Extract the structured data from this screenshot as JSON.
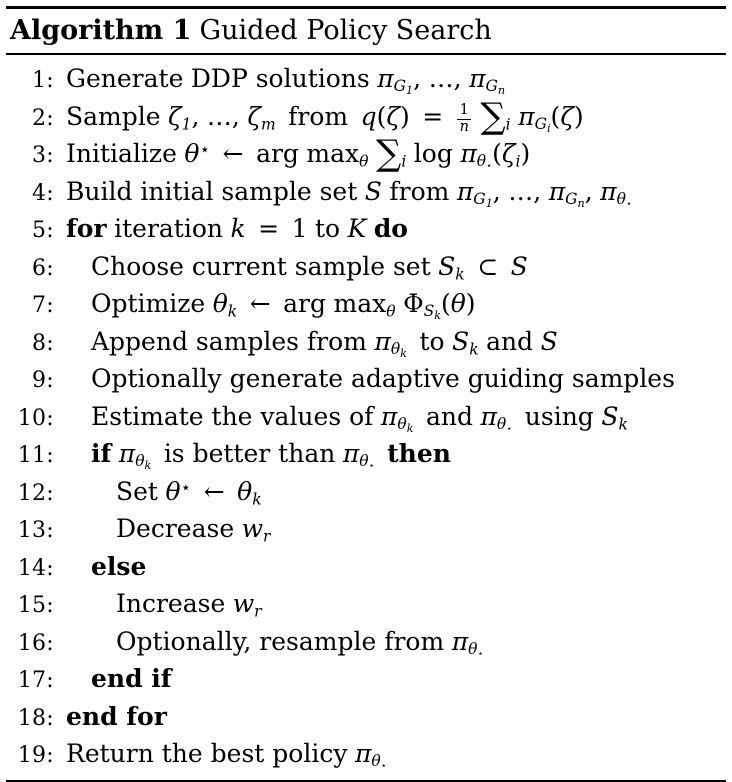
{
  "algorithm": {
    "keyword": "Algorithm 1",
    "caption": "Guided Policy Search",
    "lines": [
      {
        "n": "1:",
        "indent": 0
      },
      {
        "n": "2:",
        "indent": 0
      },
      {
        "n": "3:",
        "indent": 0
      },
      {
        "n": "4:",
        "indent": 0
      },
      {
        "n": "5:",
        "indent": 0
      },
      {
        "n": "6:",
        "indent": 1
      },
      {
        "n": "7:",
        "indent": 1
      },
      {
        "n": "8:",
        "indent": 1
      },
      {
        "n": "9:",
        "indent": 1
      },
      {
        "n": "10:",
        "indent": 1
      },
      {
        "n": "11:",
        "indent": 1
      },
      {
        "n": "12:",
        "indent": 2
      },
      {
        "n": "13:",
        "indent": 2
      },
      {
        "n": "14:",
        "indent": 1
      },
      {
        "n": "15:",
        "indent": 2
      },
      {
        "n": "16:",
        "indent": 2
      },
      {
        "n": "17:",
        "indent": 1
      },
      {
        "n": "18:",
        "indent": 0
      },
      {
        "n": "19:",
        "indent": 0
      }
    ],
    "text": {
      "l1": "Generate DDP solutions π_{𝒢₁}, … , π_{𝒢ₙ}",
      "l2": "Sample ζ₁, … , ζₘ from q(ζ) = (1/n) ∑ᵢ π_{𝒢ᵢ}(ζ)",
      "l3": "Initialize θ⋆ ← arg max_θ ∑ᵢ log π_{θ⋆}(ζᵢ)",
      "l4": "Build initial sample set 𝒮 from π_{𝒢₁}, … , π_{𝒢ₙ}, π_{θ⋆}",
      "l5": "for iteration k = 1 to K do",
      "l6": "Choose current sample set 𝒮ₖ ⊂ 𝒮",
      "l7": "Optimize θₖ ← arg max_θ Φ_{𝒮ₖ}(θ)",
      "l8": "Append samples from π_{θₖ} to 𝒮ₖ and 𝒮",
      "l9": "Optionally generate adaptive guiding samples",
      "l10": "Estimate the values of π_{θₖ} and π_{θ⋆} using 𝒮ₖ",
      "l11": "if π_{θₖ} is better than π_{θ⋆} then",
      "l12": "Set θ⋆ ← θₖ",
      "l13": "Decrease wᵣ",
      "l14": "else",
      "l15": "Increase wᵣ",
      "l16": "Optionally, resample from π_{θ⋆}",
      "l17": "end if",
      "l18": "end for",
      "l19": "Return the best policy π_{θ⋆}"
    },
    "words": {
      "generate": "Generate",
      "ddp_solutions": "DDP solutions",
      "sample": "Sample",
      "from": "from",
      "initialize": "Initialize",
      "arg": "arg",
      "max": "max",
      "log": "log",
      "build_initial": "Build initial sample set",
      "for": "for",
      "iteration": "iteration",
      "to": "to",
      "do": "do",
      "choose_current": "Choose current sample set",
      "optimize": "Optimize",
      "append_samples": "Append samples from",
      "and": "and",
      "optionally_generate": "Optionally generate adaptive guiding samples",
      "estimate_values": "Estimate the values of",
      "using": "using",
      "if": "if",
      "is_better_than": "is better than",
      "then": "then",
      "set": "Set",
      "decrease": "Decrease",
      "else": "else",
      "increase": "Increase",
      "optionally_resample": "Optionally, resample from",
      "end_if": "end if",
      "end_for": "end for",
      "return_best": "Return the best policy"
    },
    "symbols": {
      "pi": "π",
      "theta": "θ",
      "zeta": "ζ",
      "phi": "Φ",
      "star": "⋆",
      "arrow_left": "←",
      "subset": "⊂",
      "sum": "∑",
      "equals": "=",
      "dots": "…",
      "cal_g": "𝒢",
      "cal_s": "𝒮",
      "script_g_plain": "G",
      "script_s_plain": "S",
      "sub_1": "1",
      "sub_n": "n",
      "sub_m": "m",
      "sub_i": "i",
      "sub_k": "k",
      "sub_r": "r",
      "var_k": "k",
      "var_K": "K",
      "var_q": "q",
      "var_w": "w",
      "num_1": "1",
      "comma": ",",
      "lparen": "(",
      "rparen": ")"
    }
  }
}
